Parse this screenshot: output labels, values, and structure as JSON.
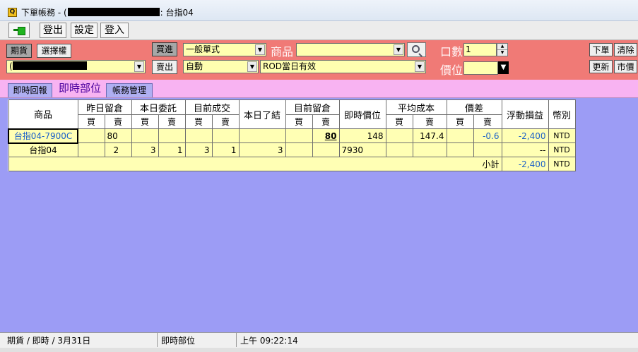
{
  "window": {
    "title_prefix": "下單帳務 - (",
    "title_suffix": ": 台指04",
    "icon_glyph": "Q"
  },
  "toolbar": {
    "logout_label": "登出",
    "settings_label": "設定",
    "login_label": "登入"
  },
  "order_panel": {
    "futures_tab": "期貨",
    "options_tab": "選擇權",
    "account_prefix": "(",
    "buy_label": "買進",
    "sell_label": "賣出",
    "order_type": "一般單式",
    "price_mode": "自動",
    "tif": "ROD當日有效",
    "product_label": "商品",
    "product_value": "",
    "qty_label": "口數",
    "qty_value": "1",
    "price_label": "價位",
    "price_value": "",
    "place_order": "下單",
    "clear": "清除",
    "update": "更新",
    "market_price": "市價"
  },
  "tabs": [
    {
      "label": "即時回報",
      "active": false
    },
    {
      "label": "即時部位",
      "active": true
    },
    {
      "label": "帳務管理",
      "active": false
    }
  ],
  "table": {
    "headers": {
      "product": "商品",
      "prev_position": "昨日留倉",
      "today_orders": "本日委託",
      "current_fills": "目前成交",
      "today_closed": "本日了結",
      "current_position": "目前留倉",
      "live_price": "即時價位",
      "avg_cost": "平均成本",
      "price_diff": "價差",
      "floating_pnl": "浮動損益",
      "currency": "幣別",
      "buy": "買",
      "sell": "賣"
    },
    "rows": [
      {
        "product": "台指04-7900C",
        "prev_buy": "",
        "prev_sell": "80",
        "order_buy": "",
        "order_sell": "",
        "fill_buy": "",
        "fill_sell": "",
        "closed": "",
        "pos_buy": "",
        "pos_sell": "80",
        "live_price": "148",
        "cost_buy": "",
        "cost_sell": "147.4",
        "diff_buy": "",
        "diff_sell": "-0.6",
        "pnl": "-2,400",
        "currency": "NTD"
      },
      {
        "product": "台指04",
        "prev_buy": "",
        "prev_sell": "2",
        "order_buy": "3",
        "order_sell": "1",
        "fill_buy": "3",
        "fill_sell": "1",
        "closed": "3",
        "pos_buy": "",
        "pos_sell": "",
        "live_price": "7930",
        "cost_buy": "",
        "cost_sell": "",
        "diff_buy": "",
        "diff_sell": "",
        "pnl": "--",
        "currency": "NTD"
      }
    ],
    "subtotal": {
      "label": "小計",
      "pnl": "-2,400",
      "currency": "NTD"
    }
  },
  "status": {
    "left": "期貨 / 即時 / 3月31日",
    "middle": "即時部位",
    "time": "上午 09:22:14"
  }
}
